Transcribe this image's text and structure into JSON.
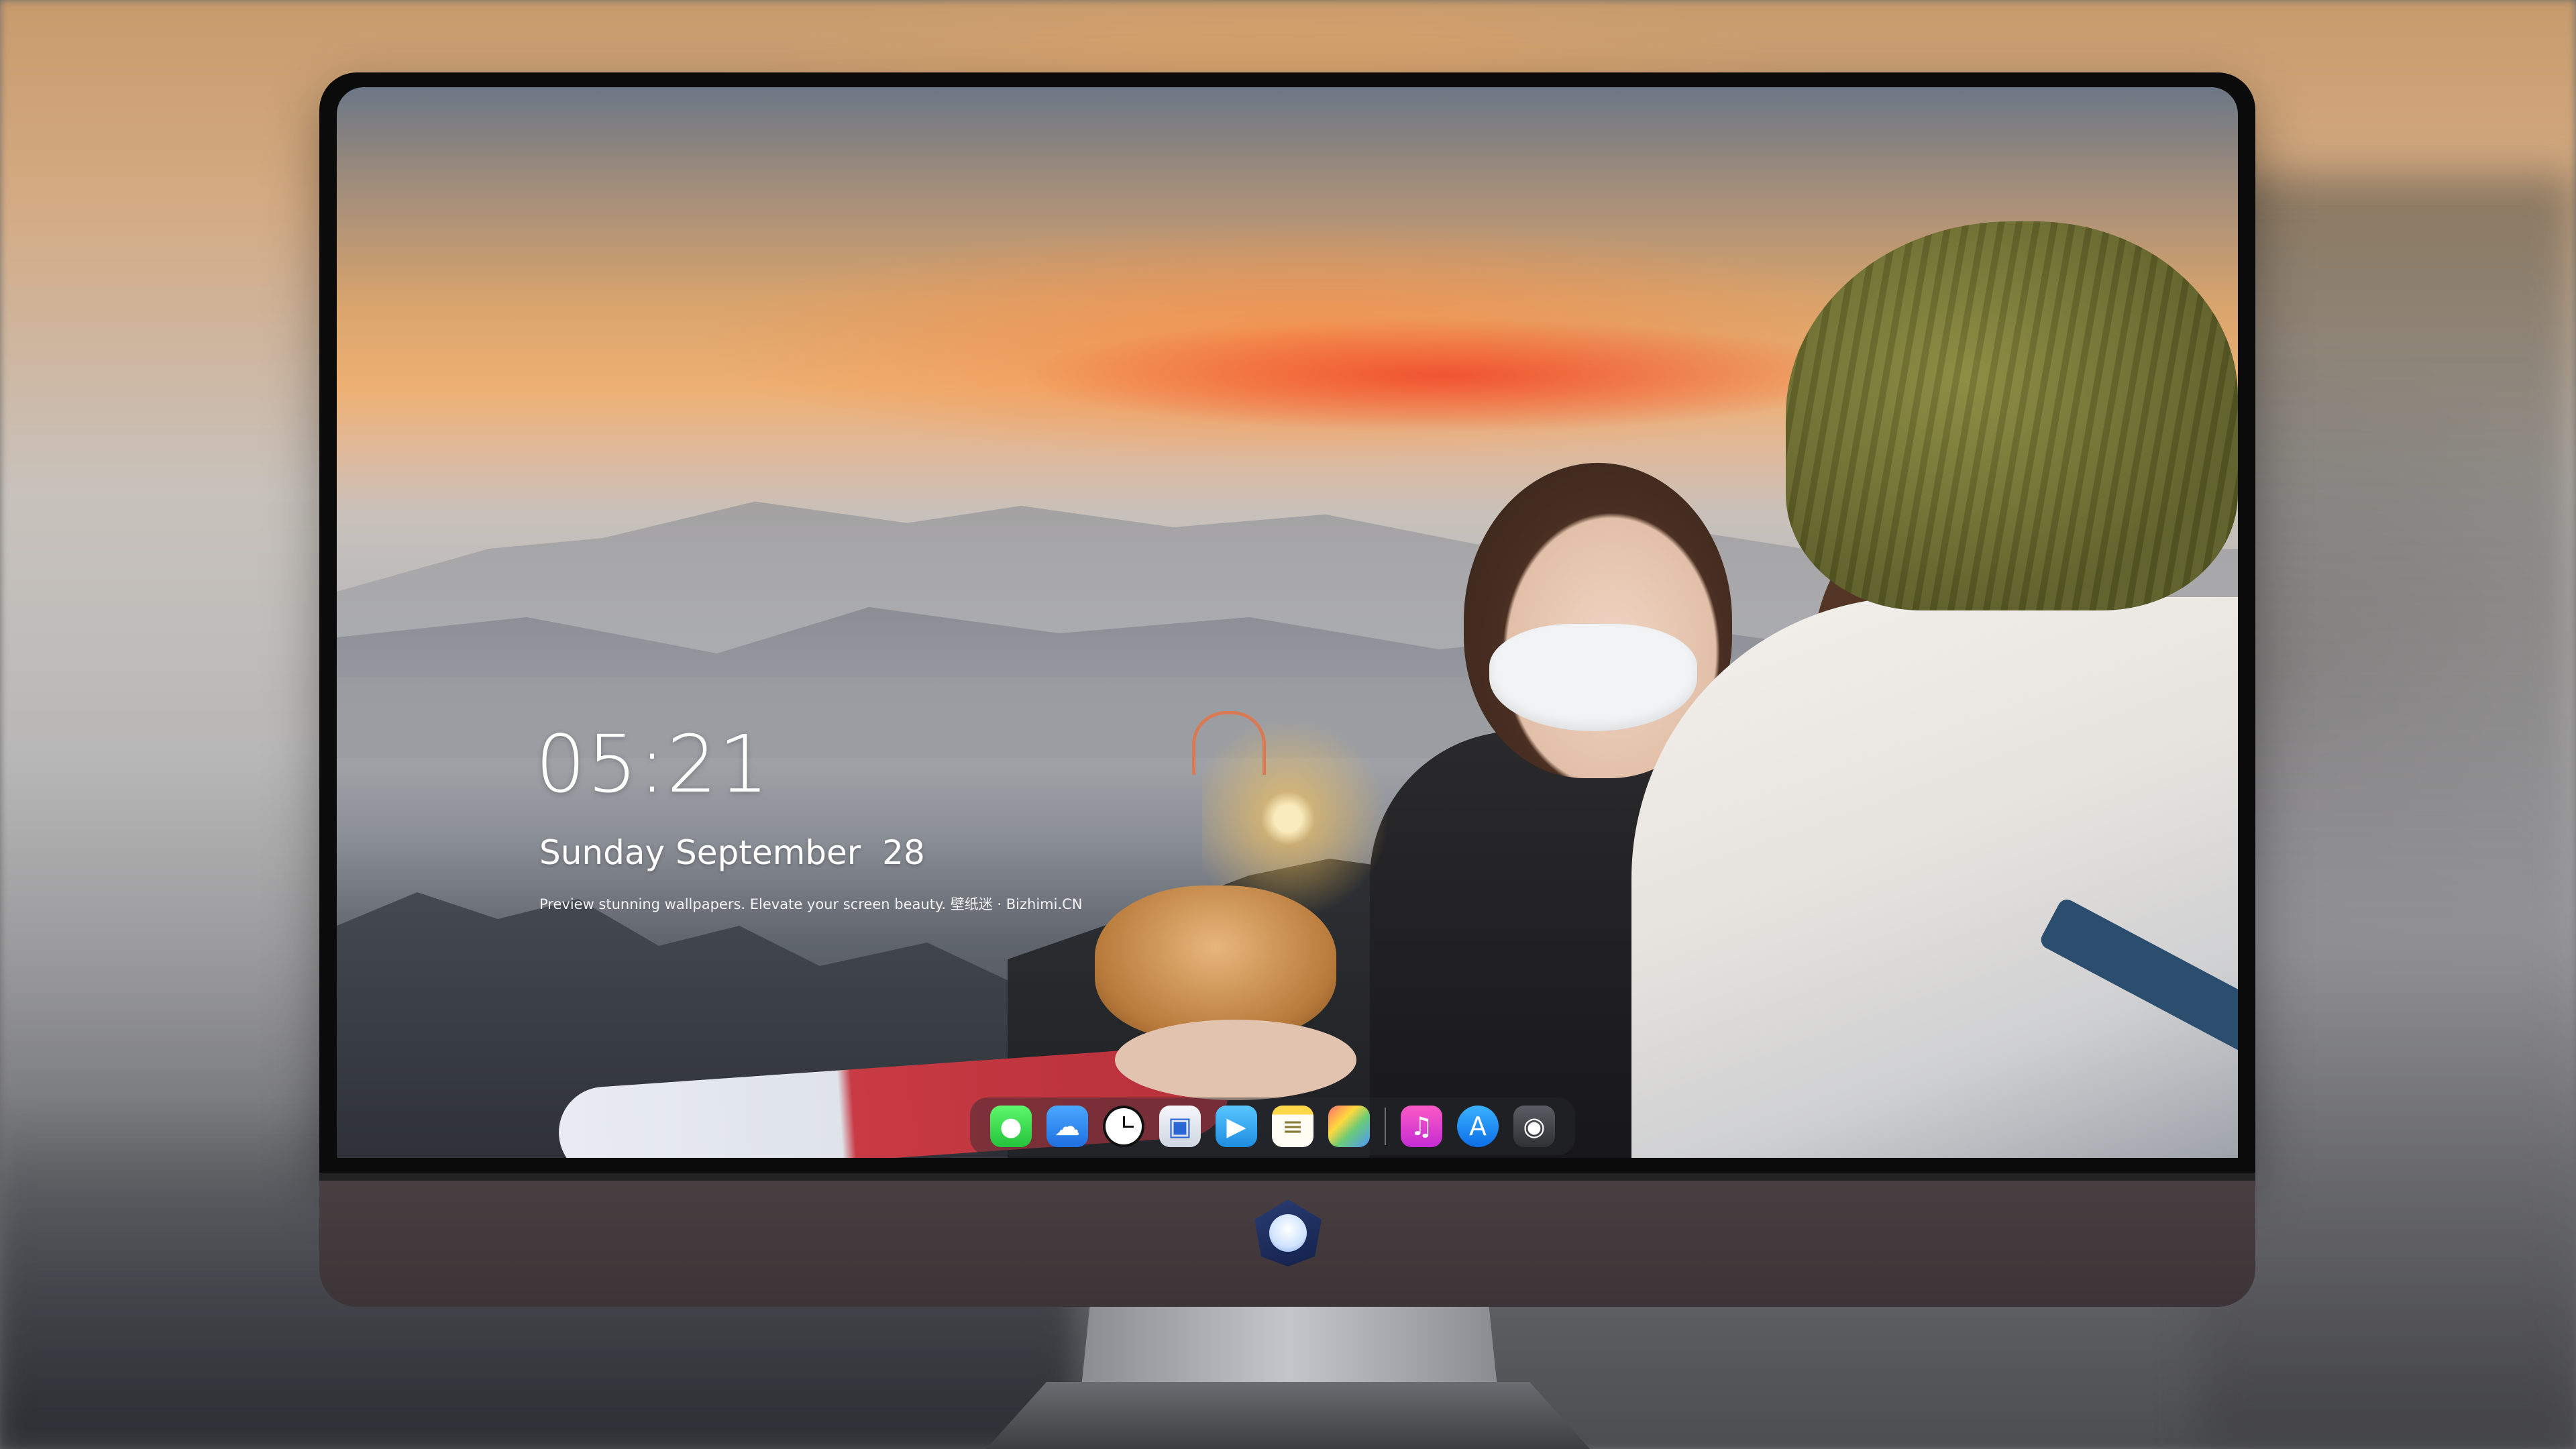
{
  "lockscreen": {
    "time": "05:21",
    "date": "Sunday September  28",
    "caption": "Preview stunning wallpapers. Elevate your screen beauty. 壁纸迷 · Bizhimi.CN"
  },
  "dock": {
    "apps": [
      {
        "name": "messages",
        "icon": "speech-bubble-icon",
        "glyph": "●"
      },
      {
        "name": "weather",
        "icon": "cloud-sun-icon",
        "glyph": "☁"
      },
      {
        "name": "clock",
        "icon": "clock-icon",
        "glyph": ""
      },
      {
        "name": "preview",
        "icon": "preview-icon",
        "glyph": "▣"
      },
      {
        "name": "video",
        "icon": "clapperboard-icon",
        "glyph": "▶"
      },
      {
        "name": "notes",
        "icon": "notes-icon",
        "glyph": "≡"
      },
      {
        "name": "photos",
        "icon": "photos-icon",
        "glyph": ""
      },
      {
        "name": "music",
        "icon": "music-note-icon",
        "glyph": "♫"
      },
      {
        "name": "app-store",
        "icon": "app-store-icon",
        "glyph": "A"
      },
      {
        "name": "camera",
        "icon": "camera-icon",
        "glyph": "◉"
      }
    ]
  },
  "colors": {
    "chin": "#3d3437",
    "bezel": "#0b0b0c",
    "dock_bg": "rgba(40,42,48,0.45)"
  }
}
